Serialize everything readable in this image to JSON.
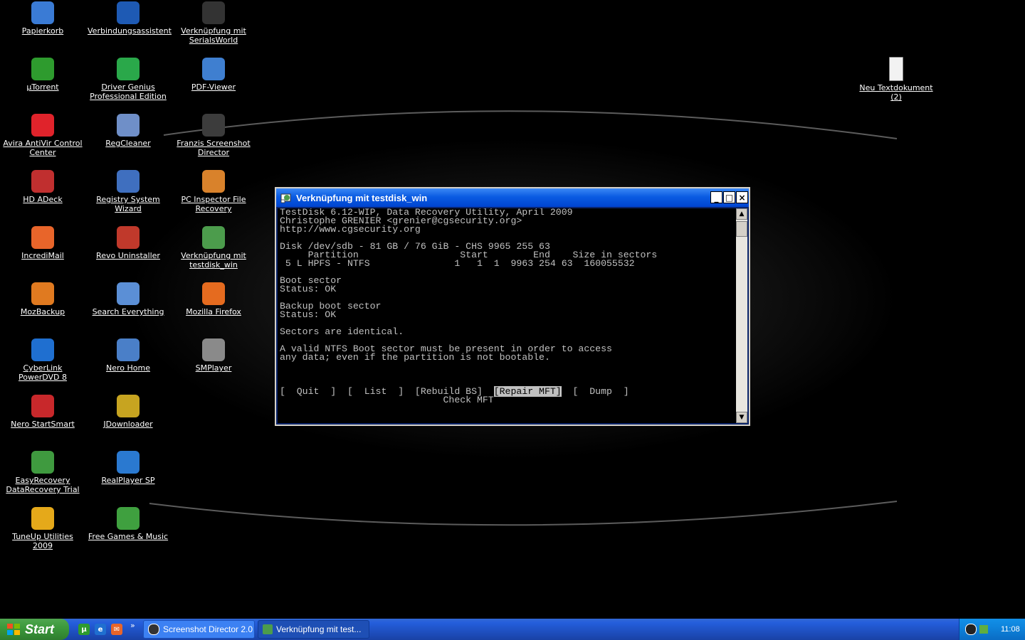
{
  "desktop": {
    "icons": [
      {
        "label": "Papierkorb",
        "icon": "recycle-bin-icon",
        "color": "#3a7bd5"
      },
      {
        "label": "Verbindungsassistent",
        "icon": "connection-wizard-icon",
        "color": "#1e5ab4"
      },
      {
        "label": "Verknüpfung mit SerialsWorld",
        "icon": "serialsworld-icon",
        "color": "#333333"
      },
      {
        "label": "µTorrent",
        "icon": "utorrent-icon",
        "color": "#2e9b2e"
      },
      {
        "label": "Driver Genius Professional Edition",
        "icon": "driver-genius-icon",
        "color": "#2aa84a"
      },
      {
        "label": "PDF-Viewer",
        "icon": "pdf-viewer-icon",
        "color": "#3f7fd0"
      },
      {
        "label": "Avira AntiVir Control Center",
        "icon": "avira-icon",
        "color": "#e0232b"
      },
      {
        "label": "RegCleaner",
        "icon": "regcleaner-icon",
        "color": "#6f8fc8"
      },
      {
        "label": "Franzis Screenshot Director",
        "icon": "screenshot-director-icon",
        "color": "#3c3c3c"
      },
      {
        "label": "HD ADeck",
        "icon": "hd-adeck-icon",
        "color": "#c02f2f"
      },
      {
        "label": "Registry System Wizard",
        "icon": "registry-wizard-icon",
        "color": "#3f6fbf"
      },
      {
        "label": "PC Inspector File Recovery",
        "icon": "file-recovery-icon",
        "color": "#d9822b"
      },
      {
        "label": "IncrediMail",
        "icon": "incredimail-icon",
        "color": "#e8652a"
      },
      {
        "label": "Revo Uninstaller",
        "icon": "revo-uninstaller-icon",
        "color": "#c0392b"
      },
      {
        "label": "Verknüpfung mit testdisk_win",
        "icon": "testdisk-icon",
        "color": "#4c9c4c"
      },
      {
        "label": "MozBackup",
        "icon": "mozbackup-icon",
        "color": "#e07a20"
      },
      {
        "label": "Search Everything",
        "icon": "search-everything-icon",
        "color": "#5b8fd6"
      },
      {
        "label": "Mozilla Firefox",
        "icon": "firefox-icon",
        "color": "#e56b1f"
      },
      {
        "label": "CyberLink PowerDVD 8",
        "icon": "powerdvd-icon",
        "color": "#1f6fd0"
      },
      {
        "label": "Nero Home",
        "icon": "nero-home-icon",
        "color": "#4a7fc8"
      },
      {
        "label": "SMPlayer",
        "icon": "smplayer-icon",
        "color": "#8a8a8a"
      },
      {
        "label": "Nero StartSmart",
        "icon": "nero-startsmart-icon",
        "color": "#c8282b"
      },
      {
        "label": "JDownloader",
        "icon": "jdownloader-icon",
        "color": "#c7a420"
      },
      {
        "label": "EasyRecovery DataRecovery Trial",
        "icon": "easyrecovery-icon",
        "color": "#3f9a3f"
      },
      {
        "label": "RealPlayer SP",
        "icon": "realplayer-icon",
        "color": "#2a79d0"
      },
      {
        "label": "TuneUp Utilities 2009",
        "icon": "tuneup-icon",
        "color": "#e5a91a"
      },
      {
        "label": "Free Games & Music",
        "icon": "free-games-icon",
        "color": "#3fa03f"
      },
      {
        "label": "Neu Textdokument (2)",
        "icon": "text-document-icon",
        "color": "#f2f2f2"
      }
    ]
  },
  "window": {
    "title": "Verknüpfung mit testdisk_win",
    "minimize_label": "_",
    "maximize_label": "□",
    "close_label": "×",
    "console_lines": [
      "TestDisk 6.12-WIP, Data Recovery Utility, April 2009",
      "Christophe GRENIER <grenier@cgsecurity.org>",
      "http://www.cgsecurity.org",
      "",
      "Disk /dev/sdb - 81 GB / 76 GiB - CHS 9965 255 63",
      "     Partition                  Start        End    Size in sectors",
      " 5 L HPFS - NTFS               1   1  1  9963 254 63  160055532",
      "",
      "Boot sector",
      "Status: OK",
      "",
      "Backup boot sector",
      "Status: OK",
      "",
      "Sectors are identical.",
      "",
      "A valid NTFS Boot sector must be present in order to access",
      "any data; even if the partition is not bootable.",
      "",
      "",
      "",
      ""
    ],
    "menu_left": "[  Quit  ]  [  List  ]  [Rebuild BS]  ",
    "menu_selected": "[Repair MFT]",
    "menu_right": "  [  Dump  ]",
    "menu_hint": "                             Check MFT"
  },
  "taskbar": {
    "start_label": "Start",
    "quicklaunch": [
      "utorrent-quicklaunch-icon",
      "ie-quicklaunch-icon",
      "incredimail-quicklaunch-icon"
    ],
    "overflow": "»",
    "tasks": [
      {
        "label": "Screenshot Director 2.0",
        "icon": "screenshot-director-task-icon"
      },
      {
        "label": "Verknüpfung mit test...",
        "icon": "testdisk-task-icon"
      }
    ],
    "clock": "11:08"
  }
}
